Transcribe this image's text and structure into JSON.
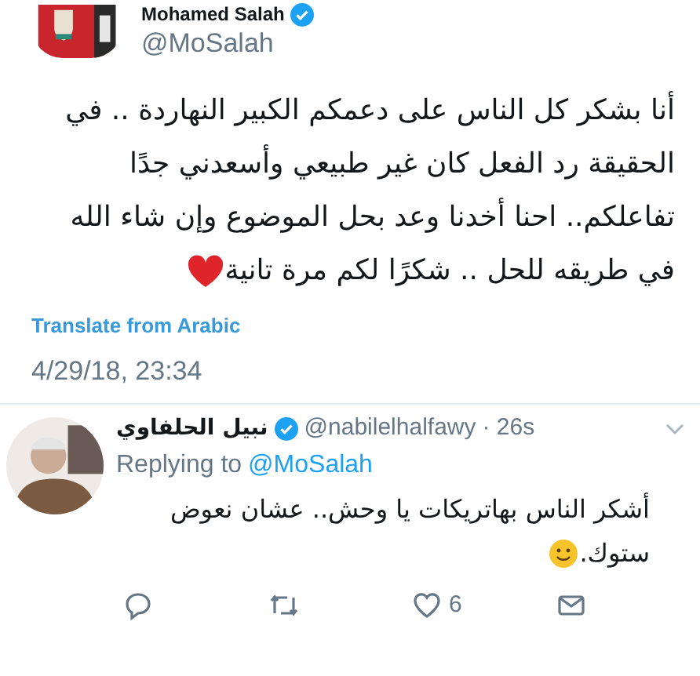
{
  "tweet": {
    "author": {
      "name": "Mohamed Salah",
      "handle": "@MoSalah",
      "verified": true
    },
    "text": "أنا بشكر كل الناس على دعمكم الكبير النهاردة .. في الحقيقة رد الفعل كان غير طبيعي وأسعدني جدًا تفاعلكم.. احنا أخدنا وعد بحل الموضوع وإن شاء الله في طريقه للحل .. شكرًا لكم مرة تانية",
    "translate_link": "Translate from Arabic",
    "timestamp": "4/29/18, 23:34"
  },
  "reply": {
    "author": {
      "name": "نبيل الحلفاوي",
      "handle": "@nabilelhalfawy",
      "verified": true
    },
    "time": "· 26s",
    "replying_label": "Replying to",
    "replying_to": "@MoSalah",
    "text": "أشكر الناس بهاتريكات يا وحش.. عشان نعوض ستوك.",
    "actions": [
      {
        "kind": "reply"
      },
      {
        "kind": "retweet"
      },
      {
        "kind": "like",
        "count": "6"
      },
      {
        "kind": "message"
      }
    ]
  }
}
